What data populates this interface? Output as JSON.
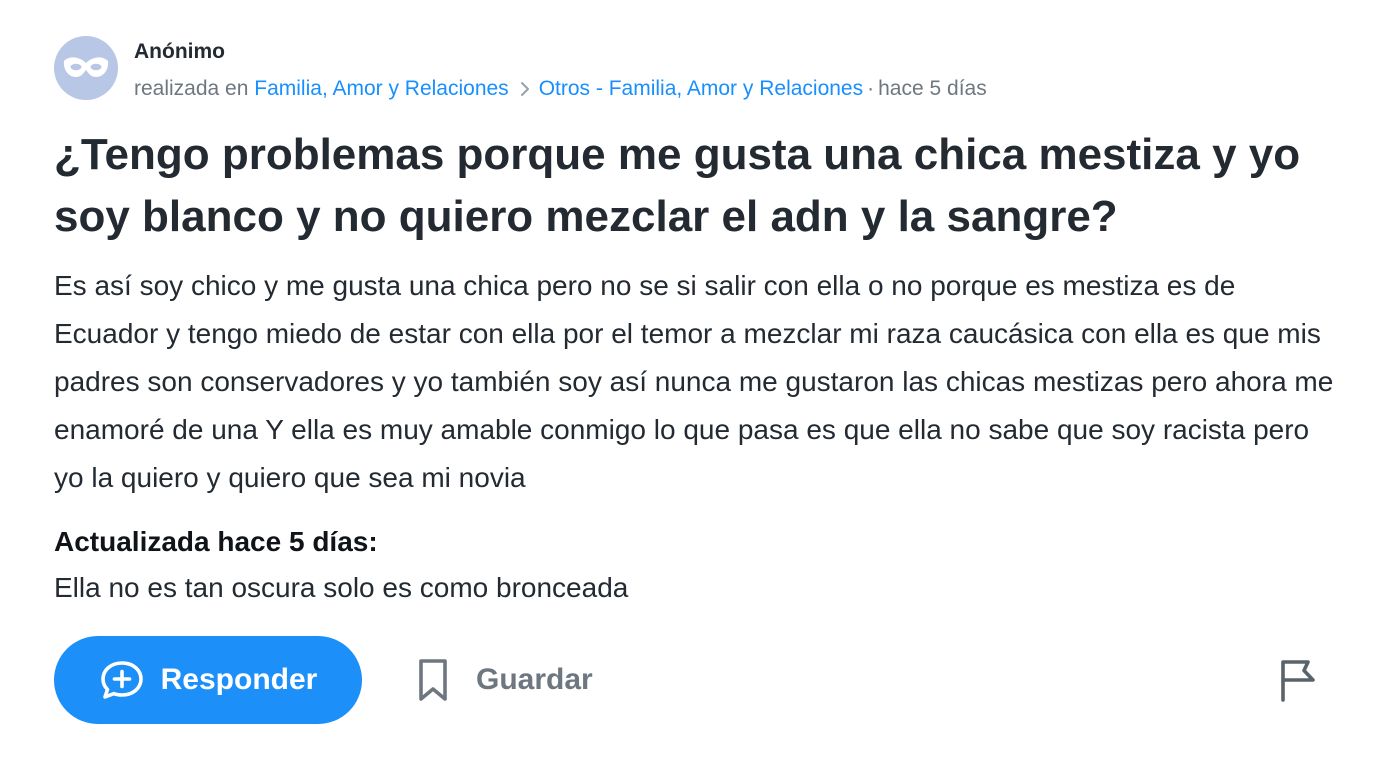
{
  "question": {
    "author": "Anónimo",
    "asked_in_prefix": "realizada en",
    "category": "Familia, Amor y Relaciones",
    "subcategory": "Otros - Familia, Amor y Relaciones",
    "separator": "·",
    "time_ago": "hace 5 días",
    "title": "¿Tengo problemas porque me gusta una chica mestiza y yo soy blanco y no quiero mezclar el adn y la sangre?",
    "body": "Es así soy chico y me gusta una chica pero no se si salir con ella o no porque es mestiza es de Ecuador y tengo miedo de estar con ella por el temor a mezclar mi raza caucásica con ella es que mis padres son conservadores y yo también soy así nunca me gustaron las chicas mestizas pero ahora me enamoré de una Y ella es muy amable conmigo lo que pasa es que ella no sabe que soy racista pero yo la quiero y quiero que sea mi novia",
    "update_label": "Actualizada hace 5 días:",
    "update_text": "Ella no es tan oscura solo es como bronceada"
  },
  "actions": {
    "reply_label": "Responder",
    "save_label": "Guardar"
  },
  "icons": {
    "avatar": "anonymous-mask-icon",
    "breadcrumb_separator": "chevron-right-icon",
    "reply": "add-comment-icon",
    "save": "bookmark-icon",
    "report": "flag-icon"
  },
  "colors": {
    "link": "#188fff",
    "primary_button": "#1d8ff9",
    "avatar_bg": "#b9c7e6",
    "muted_text": "#6e7780",
    "text": "#232a31"
  }
}
